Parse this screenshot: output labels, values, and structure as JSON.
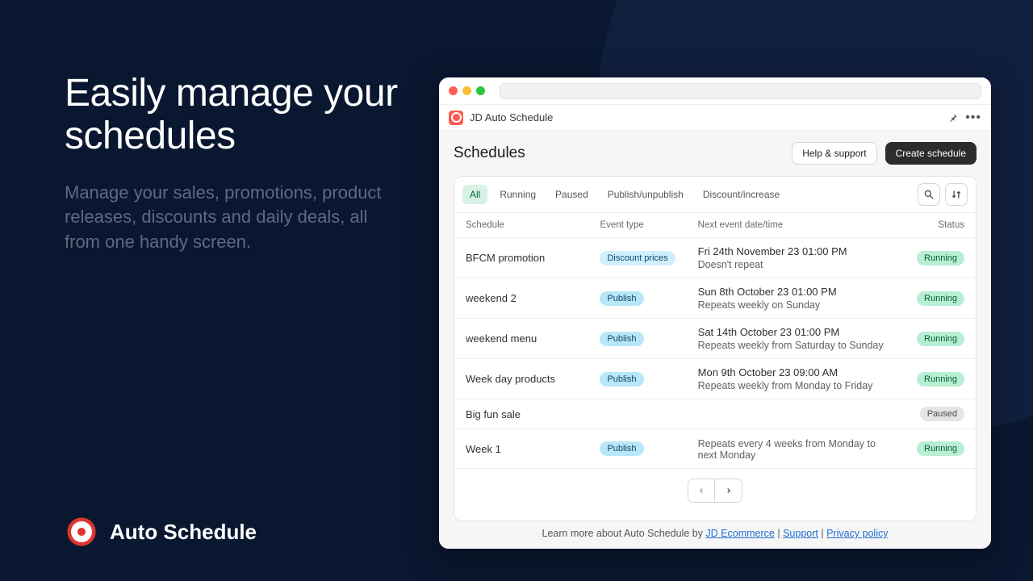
{
  "marketing": {
    "headline": "Easily manage your schedules",
    "sub": "Manage your sales, promotions, product releases, discounts and daily deals, all from one handy screen."
  },
  "brand": {
    "name": "Auto Schedule"
  },
  "app": {
    "title": "JD Auto Schedule",
    "page_title": "Schedules",
    "help_label": "Help & support",
    "create_label": "Create schedule",
    "tabs": [
      "All",
      "Running",
      "Paused",
      "Publish/unpublish",
      "Discount/increase"
    ],
    "columns": {
      "schedule": "Schedule",
      "event": "Event type",
      "next": "Next event date/time",
      "status": "Status"
    },
    "rows": [
      {
        "name": "BFCM promotion",
        "event": "Discount prices",
        "event_kind": "discount",
        "next_line1": "Fri 24th November 23 01:00 PM",
        "next_line2": "Doesn't repeat",
        "status": "Running",
        "status_kind": "running"
      },
      {
        "name": "weekend 2",
        "event": "Publish",
        "event_kind": "publish",
        "next_line1": "Sun 8th October 23 01:00 PM",
        "next_line2": "Repeats weekly on Sunday",
        "status": "Running",
        "status_kind": "running"
      },
      {
        "name": "weekend menu",
        "event": "Publish",
        "event_kind": "publish",
        "next_line1": "Sat 14th October 23 01:00 PM",
        "next_line2": "Repeats weekly from Saturday to Sunday",
        "status": "Running",
        "status_kind": "running"
      },
      {
        "name": "Week day products",
        "event": "Publish",
        "event_kind": "publish",
        "next_line1": "Mon 9th October 23 09:00 AM",
        "next_line2": "Repeats weekly from Monday to Friday",
        "status": "Running",
        "status_kind": "running"
      },
      {
        "name": "Big fun sale",
        "event": "",
        "event_kind": "",
        "next_line1": "",
        "next_line2": "",
        "status": "Paused",
        "status_kind": "paused"
      },
      {
        "name": "Week 1",
        "event": "Publish",
        "event_kind": "publish",
        "next_line1": "",
        "next_line2": "Repeats every 4 weeks from Monday to next Monday",
        "status": "Running",
        "status_kind": "running"
      }
    ],
    "footer": {
      "prefix": "Learn more about Auto Schedule by ",
      "link1": "JD Ecommerce",
      "sep": " | ",
      "link2": "Support",
      "link3": "Privacy policy"
    }
  }
}
